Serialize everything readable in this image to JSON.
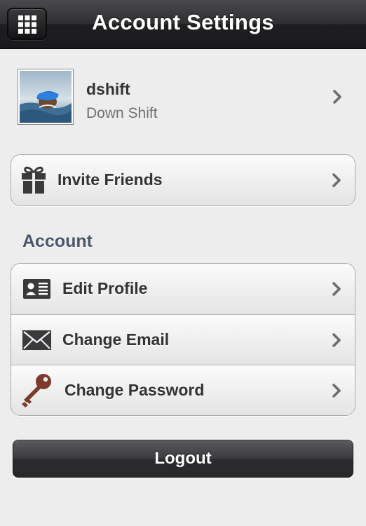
{
  "navbar": {
    "title": "Account Settings",
    "menu_icon": "grid-menu-icon"
  },
  "profile": {
    "username": "dshift",
    "full_name": "Down Shift",
    "avatar_icon": "avatar-photo"
  },
  "invite": {
    "label": "Invite Friends",
    "icon": "gift-icon"
  },
  "account_section": {
    "header": "Account",
    "items": [
      {
        "label": "Edit Profile",
        "icon": "id-card-icon"
      },
      {
        "label": "Change Email",
        "icon": "envelope-icon"
      },
      {
        "label": "Change Password",
        "icon": "key-icon"
      }
    ]
  },
  "logout": {
    "label": "Logout"
  },
  "colors": {
    "background": "#ededee",
    "navbar": "#2f2f31",
    "section_header": "#4c566a",
    "cell_text": "#333333"
  }
}
